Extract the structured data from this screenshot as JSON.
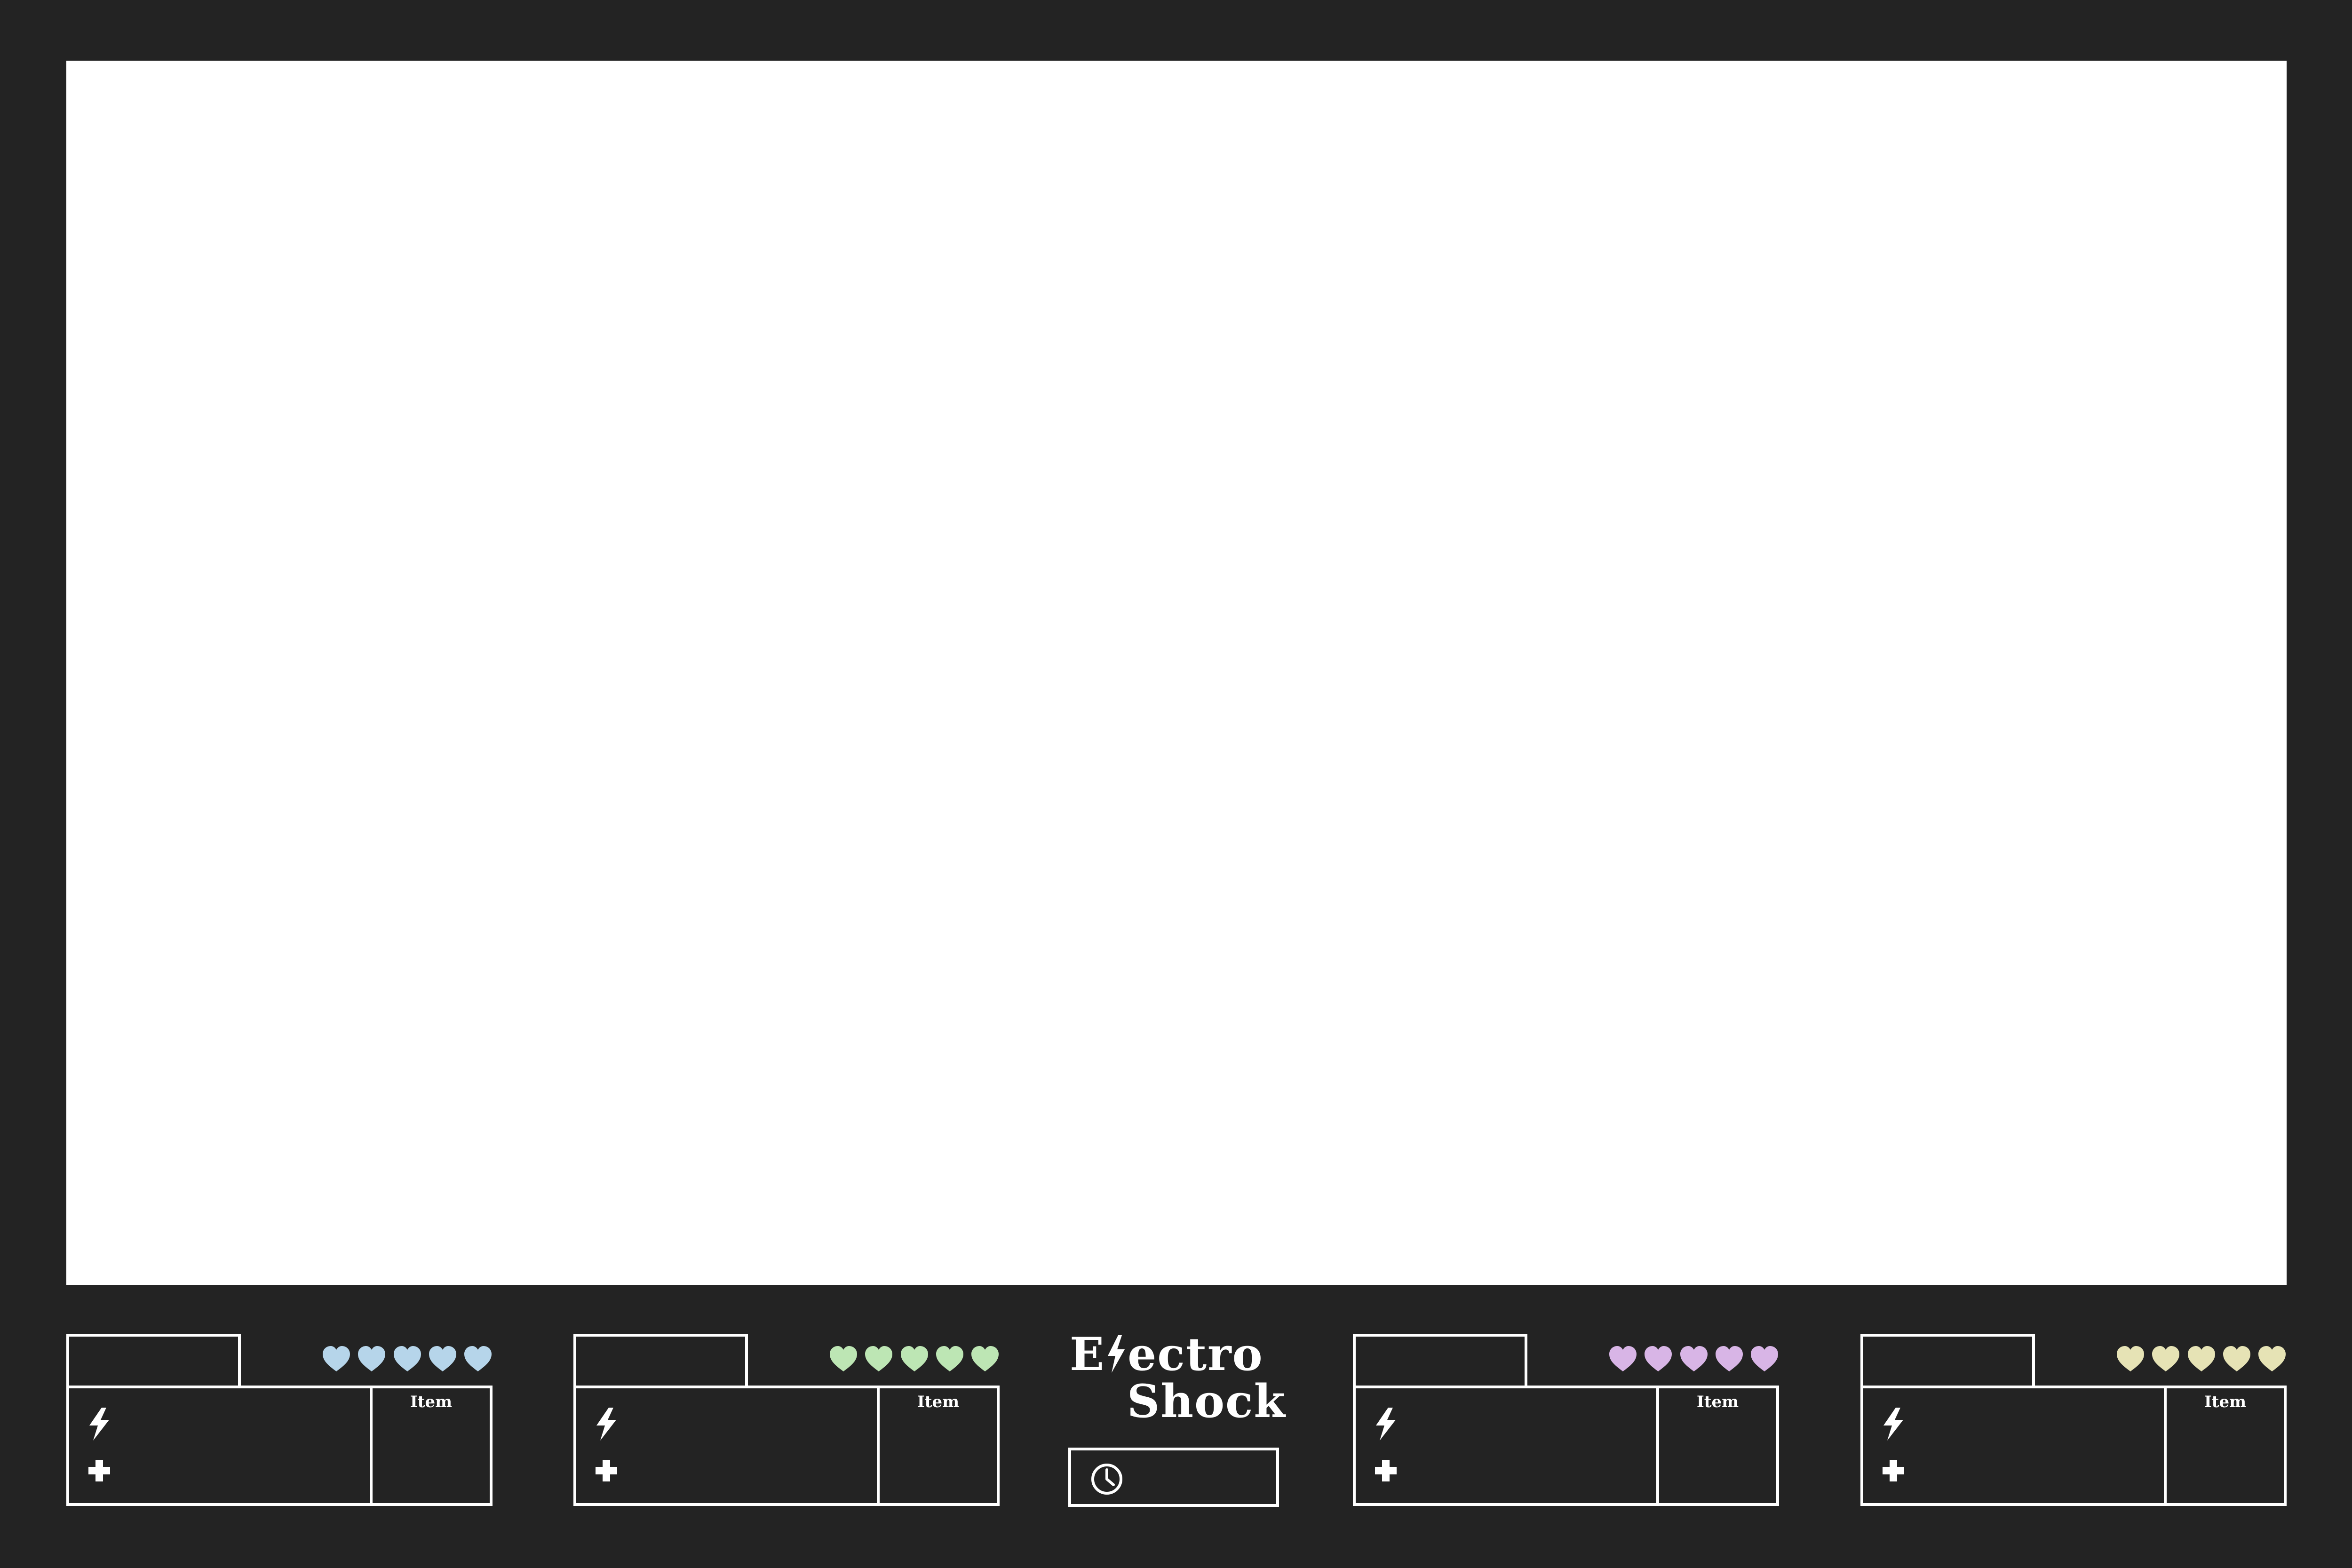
{
  "game": {
    "logo": {
      "part1": "E",
      "part2": "ectro",
      "line2": "Shock"
    },
    "players": [
      {
        "heart_color": "#b6d5ea",
        "hearts": 5,
        "item_label": "Item"
      },
      {
        "heart_color": "#bde6b4",
        "hearts": 5,
        "item_label": "Item"
      },
      {
        "heart_color": "#d8b5e6",
        "hearts": 5,
        "item_label": "Item"
      },
      {
        "heart_color": "#e6e3b5",
        "hearts": 5,
        "item_label": "Item"
      }
    ],
    "icons": {
      "energy": "lightning-bolt-icon",
      "health": "plus-icon",
      "timer": "clock-icon"
    }
  }
}
